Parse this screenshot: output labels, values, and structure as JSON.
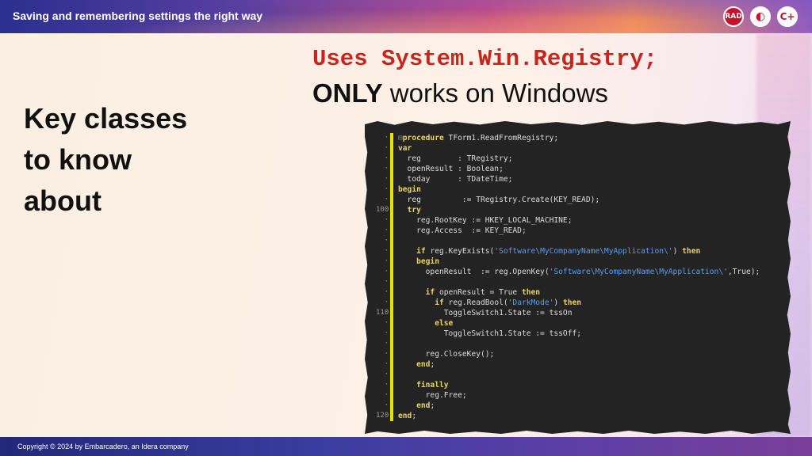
{
  "header": {
    "title": "Saving and remembering settings the right way",
    "logos": [
      {
        "name": "rad-logo",
        "text": "RAD"
      },
      {
        "name": "delphi-logo",
        "text": "◐"
      },
      {
        "name": "cpp-logo",
        "text": "C+"
      }
    ]
  },
  "slide": {
    "heading_lines": [
      "Key classes",
      "to know",
      "about"
    ],
    "uses_line": "Uses System.Win.Registry;",
    "only_bold": "ONLY",
    "only_rest": " works on Windows"
  },
  "code": {
    "lines": [
      {
        "n": "",
        "t": [
          {
            "k": "f",
            "v": "⊟"
          },
          {
            "k": "k",
            "v": "procedure"
          },
          {
            "k": "p",
            "v": " TForm1.ReadFromRegistry;"
          }
        ]
      },
      {
        "n": "",
        "t": [
          {
            "k": "k",
            "v": "var"
          }
        ]
      },
      {
        "n": "",
        "t": [
          {
            "k": "p",
            "v": "  reg        : TRegistry;"
          }
        ]
      },
      {
        "n": "",
        "t": [
          {
            "k": "p",
            "v": "  openResult : Boolean;"
          }
        ]
      },
      {
        "n": "",
        "t": [
          {
            "k": "p",
            "v": "  today      : TDateTime;"
          }
        ]
      },
      {
        "n": "",
        "t": [
          {
            "k": "k",
            "v": "begin"
          }
        ]
      },
      {
        "n": "",
        "t": [
          {
            "k": "p",
            "v": "  reg         := TRegistry.Create(KEY_READ);"
          }
        ]
      },
      {
        "n": "100",
        "t": [
          {
            "k": "p",
            "v": "  "
          },
          {
            "k": "k",
            "v": "try"
          }
        ]
      },
      {
        "n": "",
        "t": [
          {
            "k": "p",
            "v": "    reg.RootKey := HKEY_LOCAL_MACHINE;"
          }
        ]
      },
      {
        "n": "",
        "t": [
          {
            "k": "p",
            "v": "    reg.Access  := KEY_READ;"
          }
        ]
      },
      {
        "n": "",
        "t": [
          {
            "k": "p",
            "v": ""
          }
        ]
      },
      {
        "n": "",
        "t": [
          {
            "k": "p",
            "v": "    "
          },
          {
            "k": "k",
            "v": "if"
          },
          {
            "k": "p",
            "v": " reg.KeyExists("
          },
          {
            "k": "s",
            "v": "'Software\\MyCompanyName\\MyApplication\\'"
          },
          {
            "k": "p",
            "v": ") "
          },
          {
            "k": "k",
            "v": "then"
          }
        ]
      },
      {
        "n": "",
        "t": [
          {
            "k": "p",
            "v": "    "
          },
          {
            "k": "k",
            "v": "begin"
          }
        ]
      },
      {
        "n": "",
        "t": [
          {
            "k": "p",
            "v": "      openResult  := reg.OpenKey("
          },
          {
            "k": "s",
            "v": "'Software\\MyCompanyName\\MyApplication\\'"
          },
          {
            "k": "p",
            "v": ",True);"
          }
        ]
      },
      {
        "n": "",
        "t": [
          {
            "k": "p",
            "v": ""
          }
        ]
      },
      {
        "n": "",
        "t": [
          {
            "k": "p",
            "v": "      "
          },
          {
            "k": "k",
            "v": "if"
          },
          {
            "k": "p",
            "v": " openResult = True "
          },
          {
            "k": "k",
            "v": "then"
          }
        ]
      },
      {
        "n": "",
        "t": [
          {
            "k": "p",
            "v": "        "
          },
          {
            "k": "k",
            "v": "if"
          },
          {
            "k": "p",
            "v": " reg.ReadBool("
          },
          {
            "k": "s",
            "v": "'DarkMode'"
          },
          {
            "k": "p",
            "v": ") "
          },
          {
            "k": "k",
            "v": "then"
          }
        ]
      },
      {
        "n": "110",
        "t": [
          {
            "k": "p",
            "v": "          ToggleSwitch1.State := tssOn"
          }
        ]
      },
      {
        "n": "",
        "t": [
          {
            "k": "p",
            "v": "        "
          },
          {
            "k": "k",
            "v": "else"
          }
        ]
      },
      {
        "n": "",
        "t": [
          {
            "k": "p",
            "v": "          ToggleSwitch1.State := tssOff;"
          }
        ]
      },
      {
        "n": "",
        "t": [
          {
            "k": "p",
            "v": ""
          }
        ]
      },
      {
        "n": "",
        "t": [
          {
            "k": "p",
            "v": "      reg.CloseKey();"
          }
        ]
      },
      {
        "n": "",
        "t": [
          {
            "k": "p",
            "v": "    "
          },
          {
            "k": "k",
            "v": "end"
          },
          {
            "k": "p",
            "v": ";"
          }
        ]
      },
      {
        "n": "",
        "t": [
          {
            "k": "p",
            "v": ""
          }
        ]
      },
      {
        "n": "",
        "t": [
          {
            "k": "p",
            "v": "    "
          },
          {
            "k": "k",
            "v": "finally"
          }
        ]
      },
      {
        "n": "",
        "t": [
          {
            "k": "p",
            "v": "      reg.Free;"
          }
        ]
      },
      {
        "n": "",
        "t": [
          {
            "k": "p",
            "v": "    "
          },
          {
            "k": "k",
            "v": "end"
          },
          {
            "k": "p",
            "v": ";"
          }
        ]
      },
      {
        "n": "120",
        "t": [
          {
            "k": "p",
            "v": ""
          },
          {
            "k": "k",
            "v": "end"
          },
          {
            "k": "p",
            "v": ";"
          }
        ]
      }
    ]
  },
  "footer": {
    "copyright": "Copyright © 2024  by Embarcadero, an Idera company"
  },
  "colors": {
    "keyword": "#e8d36a",
    "string": "#5c9cf0",
    "uses_red": "#c8251e",
    "code_bg": "#232323"
  }
}
